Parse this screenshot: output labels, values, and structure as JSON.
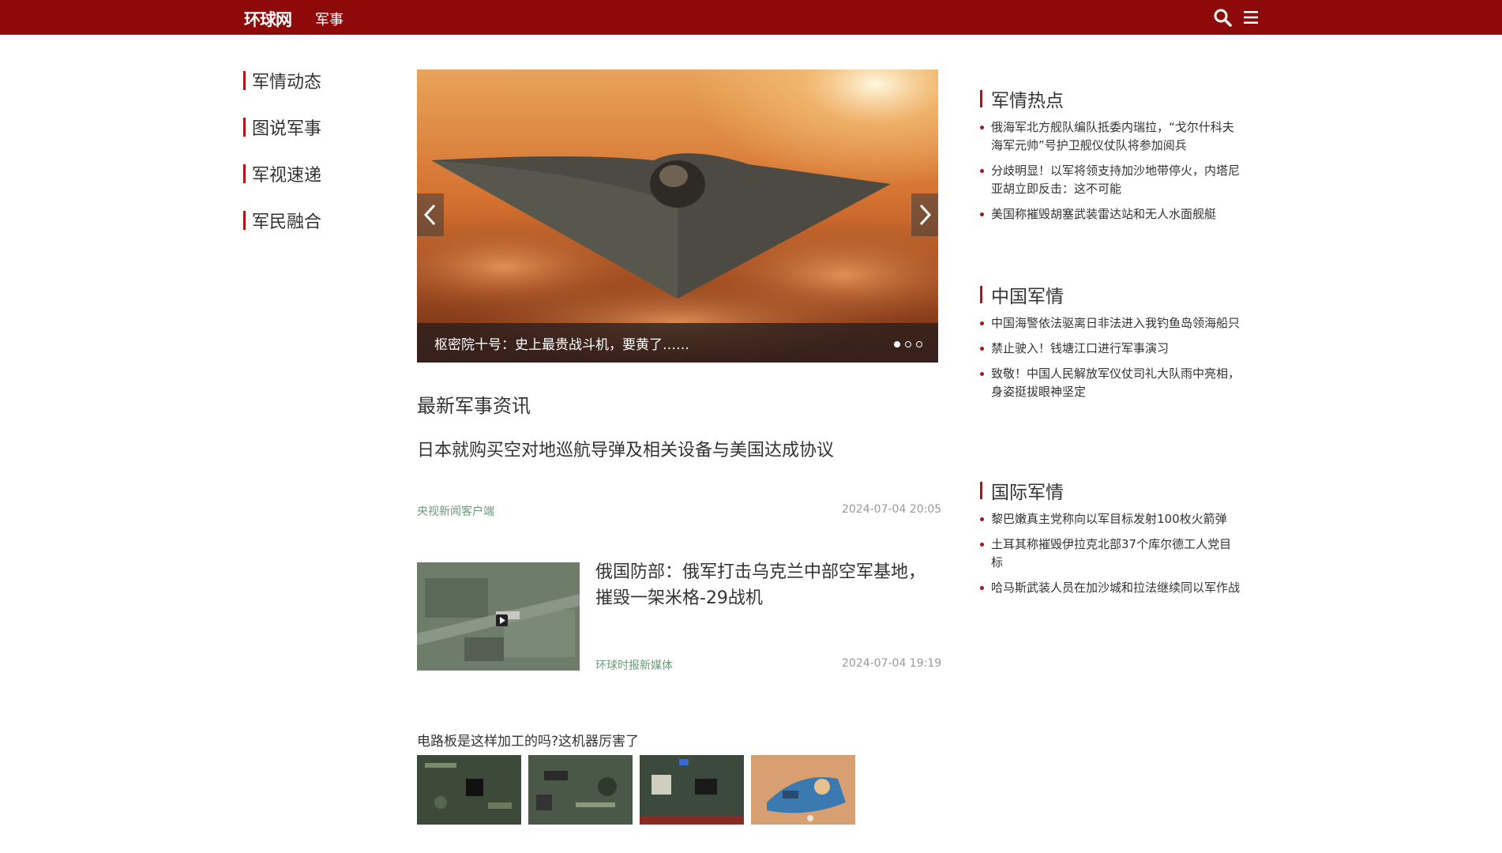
{
  "header": {
    "logo": "环球网",
    "channel": "军事",
    "search_icon": "search-icon",
    "menu_icon": "menu-icon",
    "brand_color": "#8e0a0a"
  },
  "leftnav": {
    "items": [
      {
        "label": "军情动态"
      },
      {
        "label": "图说军事"
      },
      {
        "label": "军视速递"
      },
      {
        "label": "军民融合"
      }
    ]
  },
  "carousel": {
    "caption": "枢密院十号：史上最贵战斗机，要黄了……",
    "slide_count": 3,
    "active_slide": 1,
    "prev_icon": "chevron-left-icon",
    "next_icon": "chevron-right-icon"
  },
  "latest": {
    "section_title": "最新军事资讯",
    "articles": [
      {
        "title": "日本就购买空对地巡航导弹及相关设备与美国达成协议",
        "source": "央视新闻客户端",
        "time": "2024-07-04 20:05"
      },
      {
        "title": "俄国防部：俄军打击乌克兰中部空军基地，摧毁一架米格-29战机",
        "source": "环球时报新媒体",
        "time": "2024-07-04 19:19",
        "thumb_icon": "play-icon"
      }
    ]
  },
  "video_block": {
    "title": "电路板是这样加工的吗?这机器厉害了"
  },
  "right": {
    "sections": [
      {
        "title": "军情热点",
        "items": [
          "俄海军北方舰队编队抵委内瑞拉，“戈尔什科夫海军元帅”号护卫舰仪仗队将参加阅兵",
          "分歧明显！以军将领支持加沙地带停火，内塔尼亚胡立即反击：这不可能",
          "美国称摧毁胡塞武装雷达站和无人水面舰艇"
        ]
      },
      {
        "title": "中国军情",
        "items": [
          "中国海警依法驱离日非法进入我钓鱼岛领海船只",
          "禁止驶入！钱塘江口进行军事演习",
          "致敬！中国人民解放军仪仗司礼大队雨中亮相，身姿挺拔眼神坚定"
        ]
      },
      {
        "title": "国际军情",
        "items": [
          "黎巴嫩真主党称向以军目标发射100枚火箭弹",
          "土耳其称摧毁伊拉克北部37个库尔德工人党目标",
          "哈马斯武装人员在加沙城和拉法继续同以军作战"
        ]
      }
    ]
  }
}
